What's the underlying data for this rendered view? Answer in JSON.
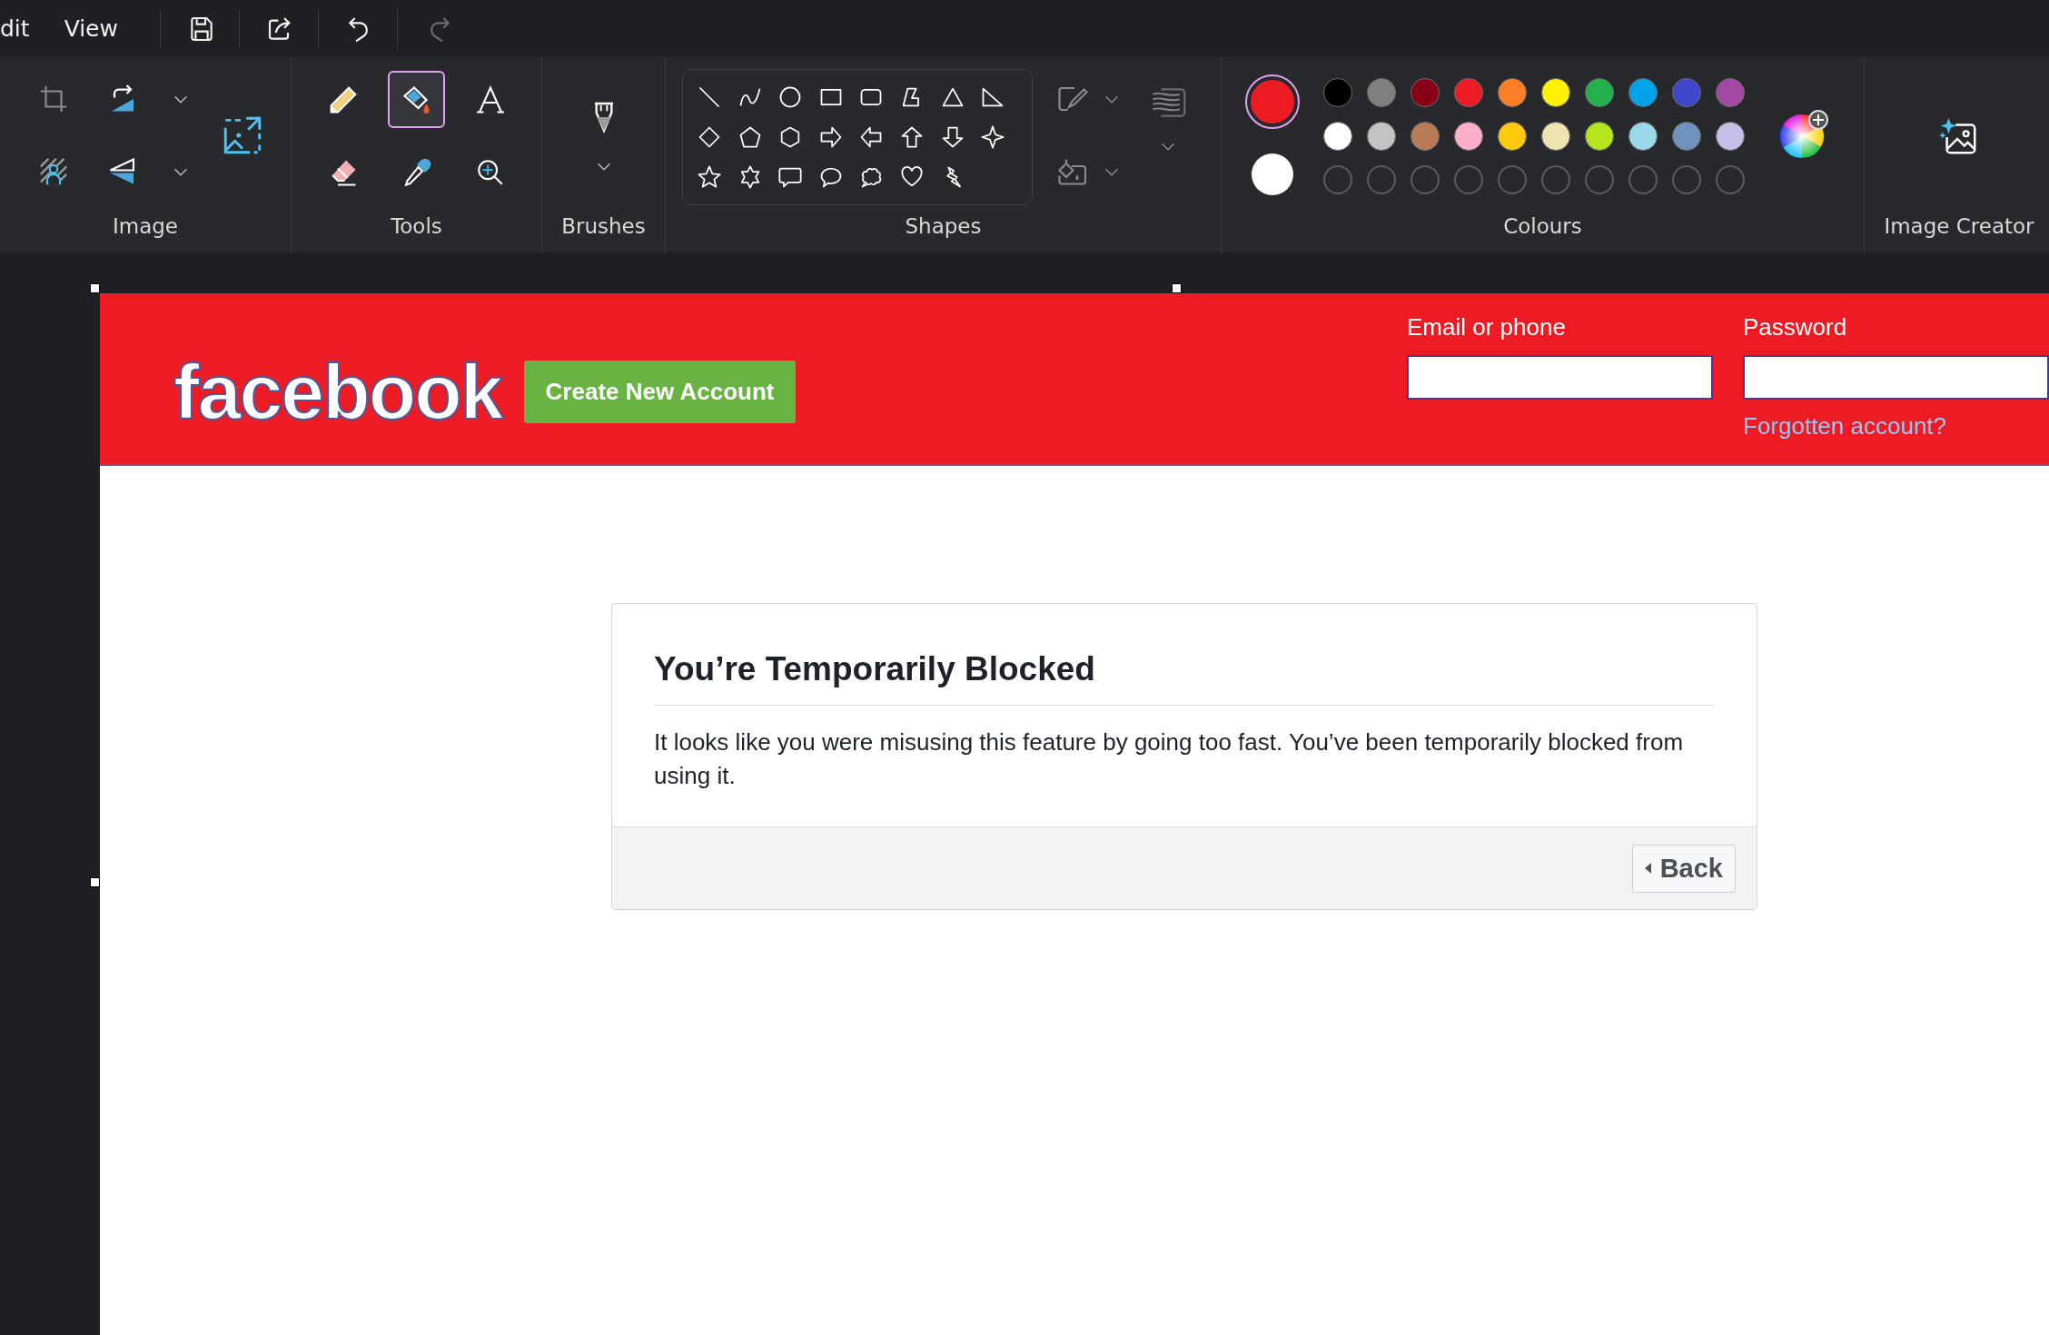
{
  "menu": [
    {
      "label": "dit"
    },
    {
      "label": "View"
    }
  ],
  "quick_actions": [
    {
      "kind": "save",
      "disabled": false
    },
    {
      "kind": "share",
      "disabled": false
    },
    {
      "kind": "undo",
      "disabled": false
    },
    {
      "kind": "redo",
      "disabled": true
    }
  ],
  "ribbon": {
    "image": {
      "label": "Image"
    },
    "tools": {
      "label": "Tools",
      "items": [
        {
          "kind": "pencil",
          "selected": false
        },
        {
          "kind": "fill",
          "selected": true
        },
        {
          "kind": "text",
          "selected": false
        },
        {
          "kind": "eraser",
          "selected": false
        },
        {
          "kind": "picker",
          "selected": false
        },
        {
          "kind": "magnifier",
          "selected": false
        }
      ]
    },
    "brushes": {
      "label": "Brushes"
    },
    "shapes": {
      "label": "Shapes"
    },
    "colours": {
      "label": "Colours",
      "primary": {
        "color": "#ed1c24",
        "selected": true
      },
      "secondary": {
        "color": "#ffffff",
        "selected": false
      },
      "palette": [
        {
          "color": "#000000"
        },
        {
          "color": "#7f7f7f"
        },
        {
          "color": "#880015"
        },
        {
          "color": "#ed1c24"
        },
        {
          "color": "#ff7f27"
        },
        {
          "color": "#fff200"
        },
        {
          "color": "#22b14c"
        },
        {
          "color": "#00a2e8"
        },
        {
          "color": "#3f48cc"
        },
        {
          "color": "#a349a4"
        },
        {
          "color": "#ffffff"
        },
        {
          "color": "#c3c3c3"
        },
        {
          "color": "#b97a57"
        },
        {
          "color": "#ffaec9"
        },
        {
          "color": "#ffc90e"
        },
        {
          "color": "#efe4b0"
        },
        {
          "color": "#b5e61d"
        },
        {
          "color": "#99d9ea"
        },
        {
          "color": "#7092be"
        },
        {
          "color": "#c8bfe7"
        }
      ]
    },
    "image_creator": {
      "label": "Image Creator"
    }
  },
  "canvas": {
    "header": {
      "logo": "facebook",
      "signup_button": "Create New Account",
      "email_label": "Email or phone",
      "password_label": "Password",
      "forgot_link": "Forgotten account?"
    },
    "dialog": {
      "title": "You’re Temporarily Blocked",
      "message": "It looks like you were misusing this feature by going too fast. You’ve been temporarily blocked from using it.",
      "back_button": "Back"
    }
  }
}
